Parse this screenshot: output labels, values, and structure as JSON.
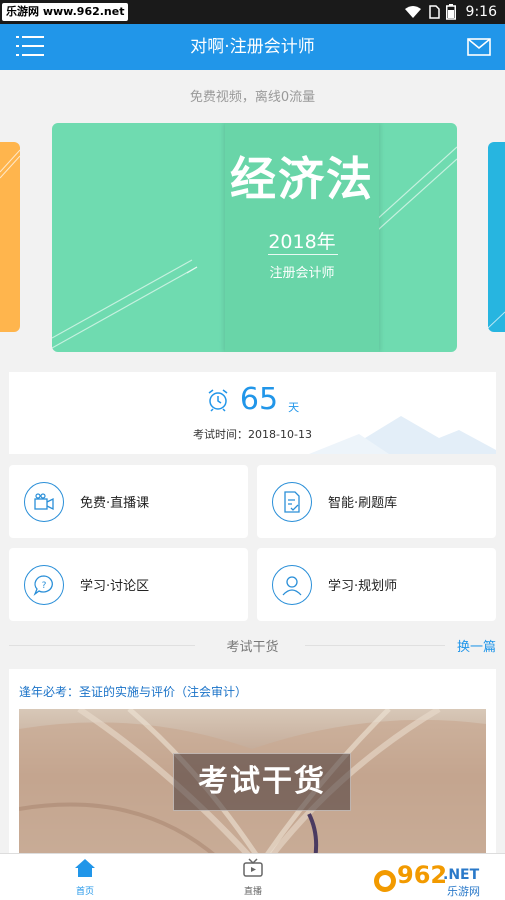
{
  "status_bar": {
    "watermark": "乐游网 www.962.net",
    "time": "9:16"
  },
  "header": {
    "title": "对啊·注册会计师"
  },
  "subtitle": "免费视频，离线0流量",
  "banner": {
    "title": "经济法",
    "year": "2018年",
    "subtitle": "注册会计师"
  },
  "countdown": {
    "days": "65",
    "unit": "天",
    "exam_date": "考试时间：2018-10-13"
  },
  "features": [
    {
      "label": "免费·直播课"
    },
    {
      "label": "智能·刷题库"
    },
    {
      "label": "学习·讨论区"
    },
    {
      "label": "学习·规划师"
    }
  ],
  "section": {
    "title": "考试干货",
    "more": "换一篇"
  },
  "article": {
    "title": "逢年必考：圣证的实施与评价（注会审计）",
    "image_label": "考试干货"
  },
  "bottom_nav": {
    "tabs": [
      {
        "label": "首页"
      },
      {
        "label": "直播"
      }
    ]
  },
  "watermark_logo": {
    "num": "962",
    "suffix": ".NET",
    "cn": "乐游网"
  },
  "colors": {
    "primary": "#2196e9",
    "banner": "#6fdbb0",
    "orange": "#ffb54d",
    "cyan": "#27b5e0"
  }
}
